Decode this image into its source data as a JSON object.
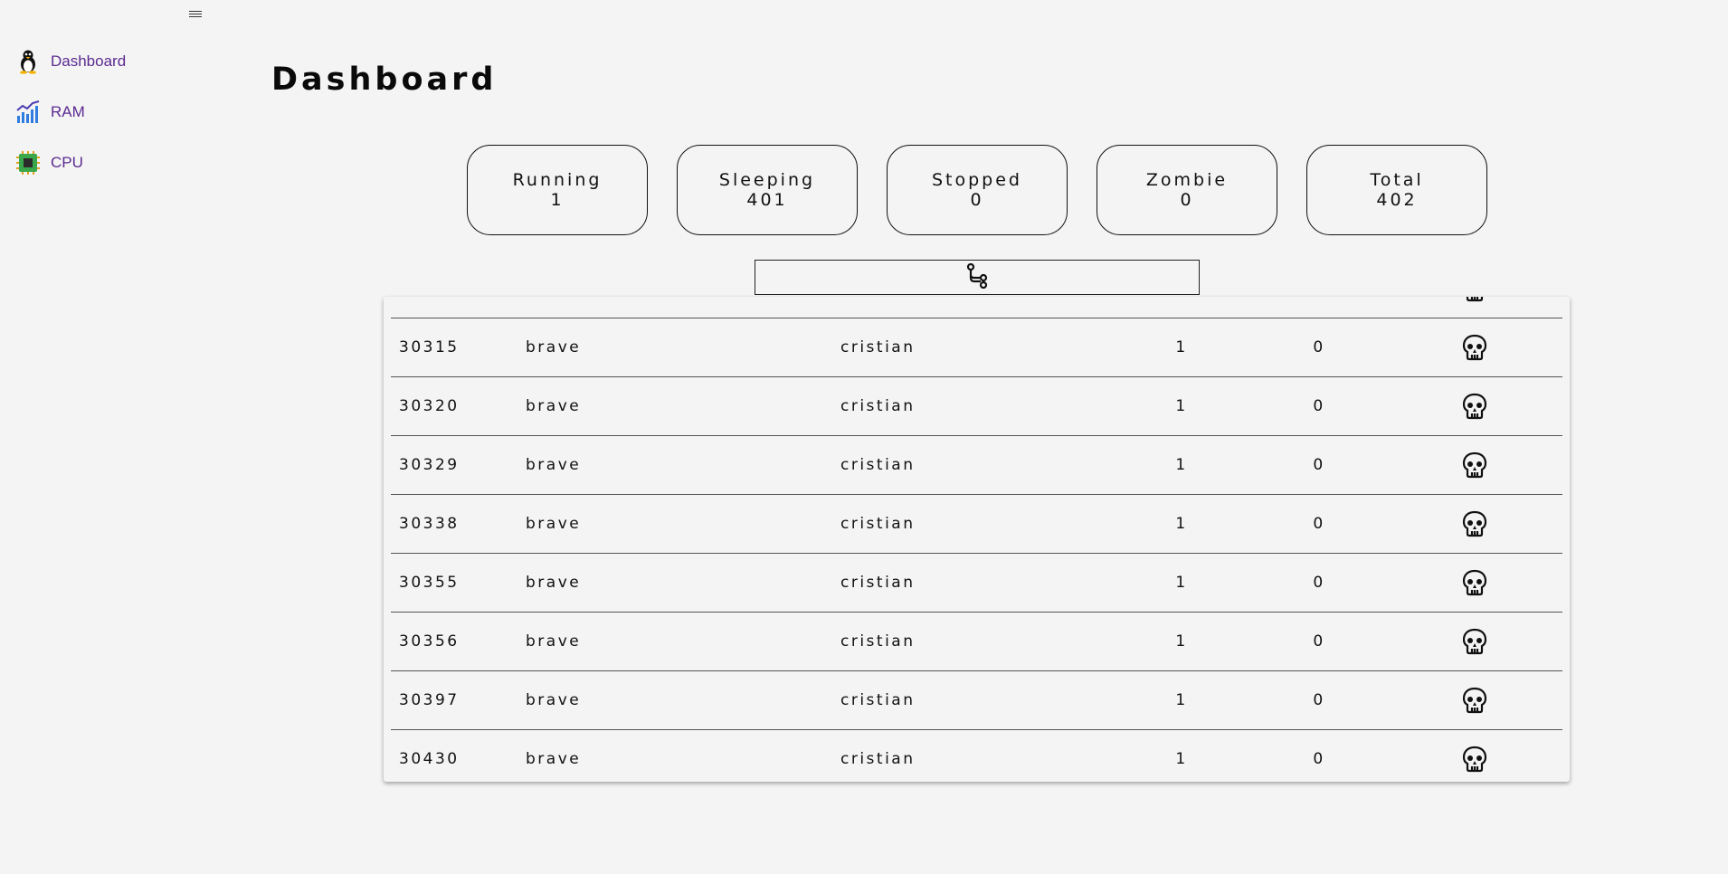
{
  "sidebar": {
    "items": [
      {
        "label": "Dashboard",
        "icon": "linux-penguin-icon"
      },
      {
        "label": "RAM",
        "icon": "ram-chart-icon"
      },
      {
        "label": "CPU",
        "icon": "cpu-chip-icon"
      }
    ]
  },
  "page": {
    "title": "Dashboard"
  },
  "stats": [
    {
      "label": "Running",
      "value": "1"
    },
    {
      "label": "Sleeping",
      "value": "401"
    },
    {
      "label": "Stopped",
      "value": "0"
    },
    {
      "label": "Zombie",
      "value": "0"
    },
    {
      "label": "Total",
      "value": "402"
    }
  ],
  "filter": {
    "icon": "process-tree-icon"
  },
  "processes": [
    {
      "pid": "",
      "name": "",
      "user": "",
      "a": "",
      "b": ""
    },
    {
      "pid": "30315",
      "name": "brave",
      "user": "cristian",
      "a": "1",
      "b": "0"
    },
    {
      "pid": "30320",
      "name": "brave",
      "user": "cristian",
      "a": "1",
      "b": "0"
    },
    {
      "pid": "30329",
      "name": "brave",
      "user": "cristian",
      "a": "1",
      "b": "0"
    },
    {
      "pid": "30338",
      "name": "brave",
      "user": "cristian",
      "a": "1",
      "b": "0"
    },
    {
      "pid": "30355",
      "name": "brave",
      "user": "cristian",
      "a": "1",
      "b": "0"
    },
    {
      "pid": "30356",
      "name": "brave",
      "user": "cristian",
      "a": "1",
      "b": "0"
    },
    {
      "pid": "30397",
      "name": "brave",
      "user": "cristian",
      "a": "1",
      "b": "0"
    },
    {
      "pid": "30430",
      "name": "brave",
      "user": "cristian",
      "a": "1",
      "b": "0"
    }
  ],
  "colors": {
    "background": "#f4f4f4",
    "nav_link": "#5b2a91"
  }
}
